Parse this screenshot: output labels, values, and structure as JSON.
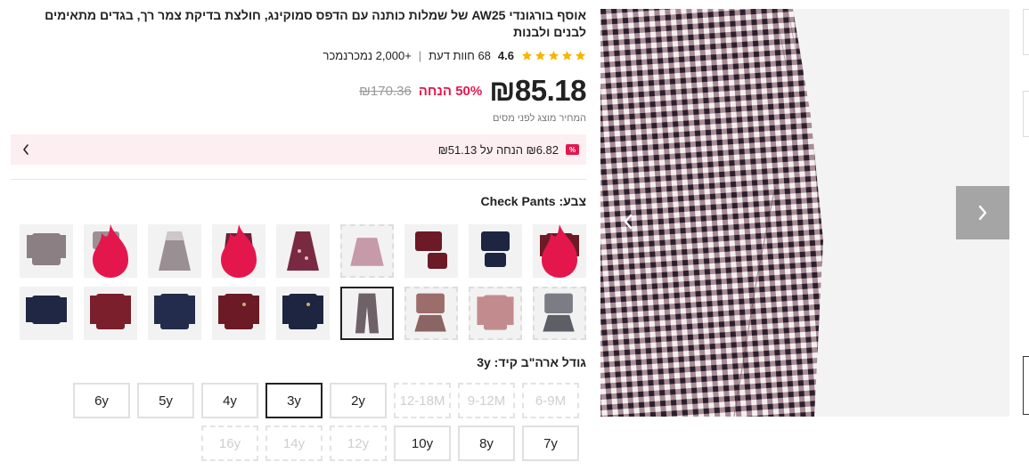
{
  "product": {
    "title": "אוסף בורגונדי AW25 של שמלות כותנה עם הדפס סמוקינג, חולצת בדיקת צמר רך, בגדים מתאימים לבנים ולבנות",
    "rating": {
      "stars": 5,
      "value": "4.6",
      "reviews": "68 חוות דעת",
      "separator": "|",
      "sold": "+2,000 נמכרנמכר"
    },
    "price": {
      "current": "₪85.18",
      "discount": "50% הנחה",
      "original": "₪170.36",
      "note": "המחיר מוצג לפני מסים"
    },
    "promo": {
      "badge": "%",
      "text": "₪6.82 הנחה על ₪51.13"
    },
    "color": {
      "label": "צבע: Check Pants",
      "options": [
        {
          "name": "burgundy-cardigan-set",
          "selected": false,
          "soldout": false,
          "hot": true
        },
        {
          "name": "navy-cardigan-set",
          "selected": false,
          "soldout": false,
          "hot": false
        },
        {
          "name": "burgundy-knit-set",
          "selected": false,
          "soldout": false,
          "hot": false
        },
        {
          "name": "pink-check-skirt",
          "selected": false,
          "soldout": true,
          "hot": false
        },
        {
          "name": "burgundy-floral-dress",
          "selected": false,
          "soldout": false,
          "hot": false
        },
        {
          "name": "burgundy-floral-romper",
          "selected": false,
          "soldout": false,
          "hot": true
        },
        {
          "name": "check-dress",
          "selected": false,
          "soldout": false,
          "hot": false
        },
        {
          "name": "check-set-with-bloomers",
          "selected": false,
          "soldout": false,
          "hot": true
        },
        {
          "name": "check-shirt",
          "selected": false,
          "soldout": false,
          "hot": false
        },
        {
          "name": "grey-cardigan-skirt-set",
          "selected": false,
          "soldout": true,
          "hot": false
        },
        {
          "name": "pink-ribbed-top",
          "selected": false,
          "soldout": true,
          "hot": false
        },
        {
          "name": "mauve-cardigan-skirt-set",
          "selected": false,
          "soldout": true,
          "hot": false
        },
        {
          "name": "check-pants",
          "selected": true,
          "soldout": false,
          "hot": false
        },
        {
          "name": "navy-crest-cardigan",
          "selected": false,
          "soldout": false,
          "hot": false
        },
        {
          "name": "burgundy-crest-cardigan",
          "selected": false,
          "soldout": false,
          "hot": false
        },
        {
          "name": "navy-cardigan",
          "selected": false,
          "soldout": false,
          "hot": false
        },
        {
          "name": "burgundy-cardigan",
          "selected": false,
          "soldout": false,
          "hot": false
        },
        {
          "name": "navy-cropped-cardigan",
          "selected": false,
          "soldout": false,
          "hot": false
        }
      ]
    },
    "size": {
      "label": "גודל ארה\"ב קיד: 3y",
      "options": [
        {
          "label": "6-9M",
          "state": "disabled"
        },
        {
          "label": "9-12M",
          "state": "disabled"
        },
        {
          "label": "12-18M",
          "state": "disabled"
        },
        {
          "label": "2y",
          "state": "available"
        },
        {
          "label": "3y",
          "state": "selected"
        },
        {
          "label": "4y",
          "state": "available"
        },
        {
          "label": "5y",
          "state": "available"
        },
        {
          "label": "6y",
          "state": "available"
        },
        {
          "label": "7y",
          "state": "available"
        },
        {
          "label": "8y",
          "state": "available"
        },
        {
          "label": "10y",
          "state": "available"
        },
        {
          "label": "12y",
          "state": "disabled"
        },
        {
          "label": "14y",
          "state": "disabled"
        },
        {
          "label": "16y",
          "state": "disabled"
        }
      ]
    }
  },
  "gallery": {
    "image": "check-pants-photo",
    "prev_icon": "chevron-left-icon",
    "next_icon": "chevron-right-icon"
  },
  "colors": {
    "accent": "#e4174d",
    "promo_bg": "#fdeef1",
    "star": "#f6b501",
    "burgundy": "#6b1a26",
    "navy": "#1d2540"
  }
}
